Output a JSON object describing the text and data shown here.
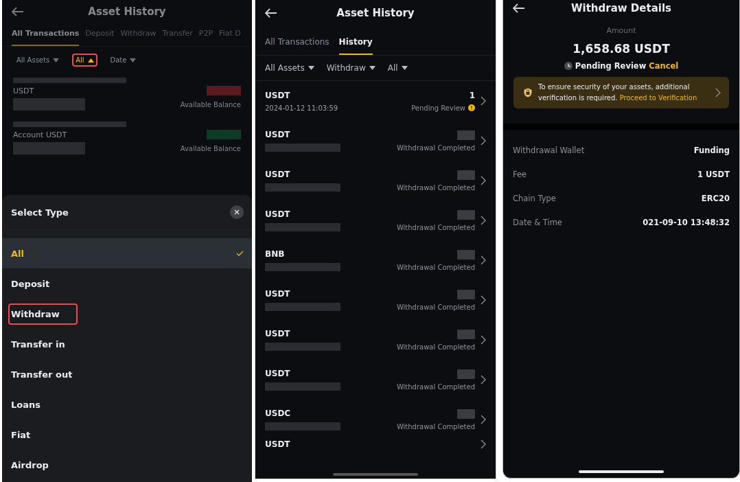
{
  "left_screen": {
    "header": {
      "title": "Asset History"
    },
    "tabs": [
      {
        "label": "All Transactions",
        "selected": true
      },
      {
        "label": "Deposit",
        "selected": false
      },
      {
        "label": "Withdraw",
        "selected": false
      },
      {
        "label": "Transfer",
        "selected": false
      },
      {
        "label": "P2P",
        "selected": false
      },
      {
        "label": "Fiat D",
        "selected": false
      }
    ],
    "filters": [
      {
        "label": "All Assets",
        "active": false,
        "highlighted": false
      },
      {
        "label": "All",
        "active": true,
        "highlighted": true
      },
      {
        "label": "Date",
        "active": false,
        "highlighted": false
      }
    ],
    "items": [
      {
        "asset": "USDT",
        "balance_label": "Available Balance",
        "color": "#5a1a22"
      },
      {
        "asset": "Account USDT",
        "balance_label": "Available Balance",
        "color": "#0f3a26"
      }
    ],
    "sheet": {
      "title": "Select Type",
      "options": [
        {
          "label": "All",
          "selected": true,
          "highlighted": false
        },
        {
          "label": "Deposit",
          "selected": false,
          "highlighted": false
        },
        {
          "label": "Withdraw",
          "selected": false,
          "highlighted": true
        },
        {
          "label": "Transfer in",
          "selected": false,
          "highlighted": false
        },
        {
          "label": "Transfer out",
          "selected": false,
          "highlighted": false
        },
        {
          "label": "Loans",
          "selected": false,
          "highlighted": false
        },
        {
          "label": "Fiat",
          "selected": false,
          "highlighted": false
        },
        {
          "label": "Airdrop",
          "selected": false,
          "highlighted": false
        }
      ]
    }
  },
  "middle_screen": {
    "header": {
      "title": "Asset History"
    },
    "tabs": [
      {
        "label": "All Transactions",
        "selected": false
      },
      {
        "label": "History",
        "selected": true
      }
    ],
    "filters": [
      {
        "label": "All Assets"
      },
      {
        "label": "Withdraw"
      },
      {
        "label": "All"
      }
    ],
    "rows": [
      {
        "asset": "USDT",
        "date": "2024-01-12 11:03:59",
        "amount": "1",
        "status": "Pending Review",
        "kind": "pending"
      },
      {
        "asset": "USDT",
        "status": "Withdrawal Completed",
        "kind": "completed"
      },
      {
        "asset": "USDT",
        "status": "Withdrawal Completed",
        "kind": "completed"
      },
      {
        "asset": "USDT",
        "status": "Withdrawal Completed",
        "kind": "completed"
      },
      {
        "asset": "BNB",
        "status": "Withdrawal Completed",
        "kind": "completed"
      },
      {
        "asset": "USDT",
        "status": "Withdrawal Completed",
        "kind": "completed"
      },
      {
        "asset": "USDT",
        "status": "Withdrawal Completed",
        "kind": "completed"
      },
      {
        "asset": "USDT",
        "status": "Withdrawal Completed",
        "kind": "completed"
      },
      {
        "asset": "USDC",
        "status": "Withdrawal Completed",
        "kind": "completed"
      },
      {
        "asset": "USDT",
        "kind": "partial"
      }
    ]
  },
  "right_screen": {
    "header": {
      "title": "Withdraw Details"
    },
    "amount_label": "Amount",
    "amount": "1,658.68 USDT",
    "status": "Pending Review",
    "cancel": "Cancel",
    "notice": {
      "text": "To ensure security of your assets, additional verification is required.",
      "link": "Proceed to Verification"
    },
    "details": [
      {
        "label": "Withdrawal Wallet",
        "value": "Funding"
      },
      {
        "label": "Fee",
        "value": "1 USDT"
      },
      {
        "label": "Chain Type",
        "value": "ERC20"
      },
      {
        "label": "Date & Time",
        "value": "021-09-10 13:48:32"
      }
    ]
  }
}
